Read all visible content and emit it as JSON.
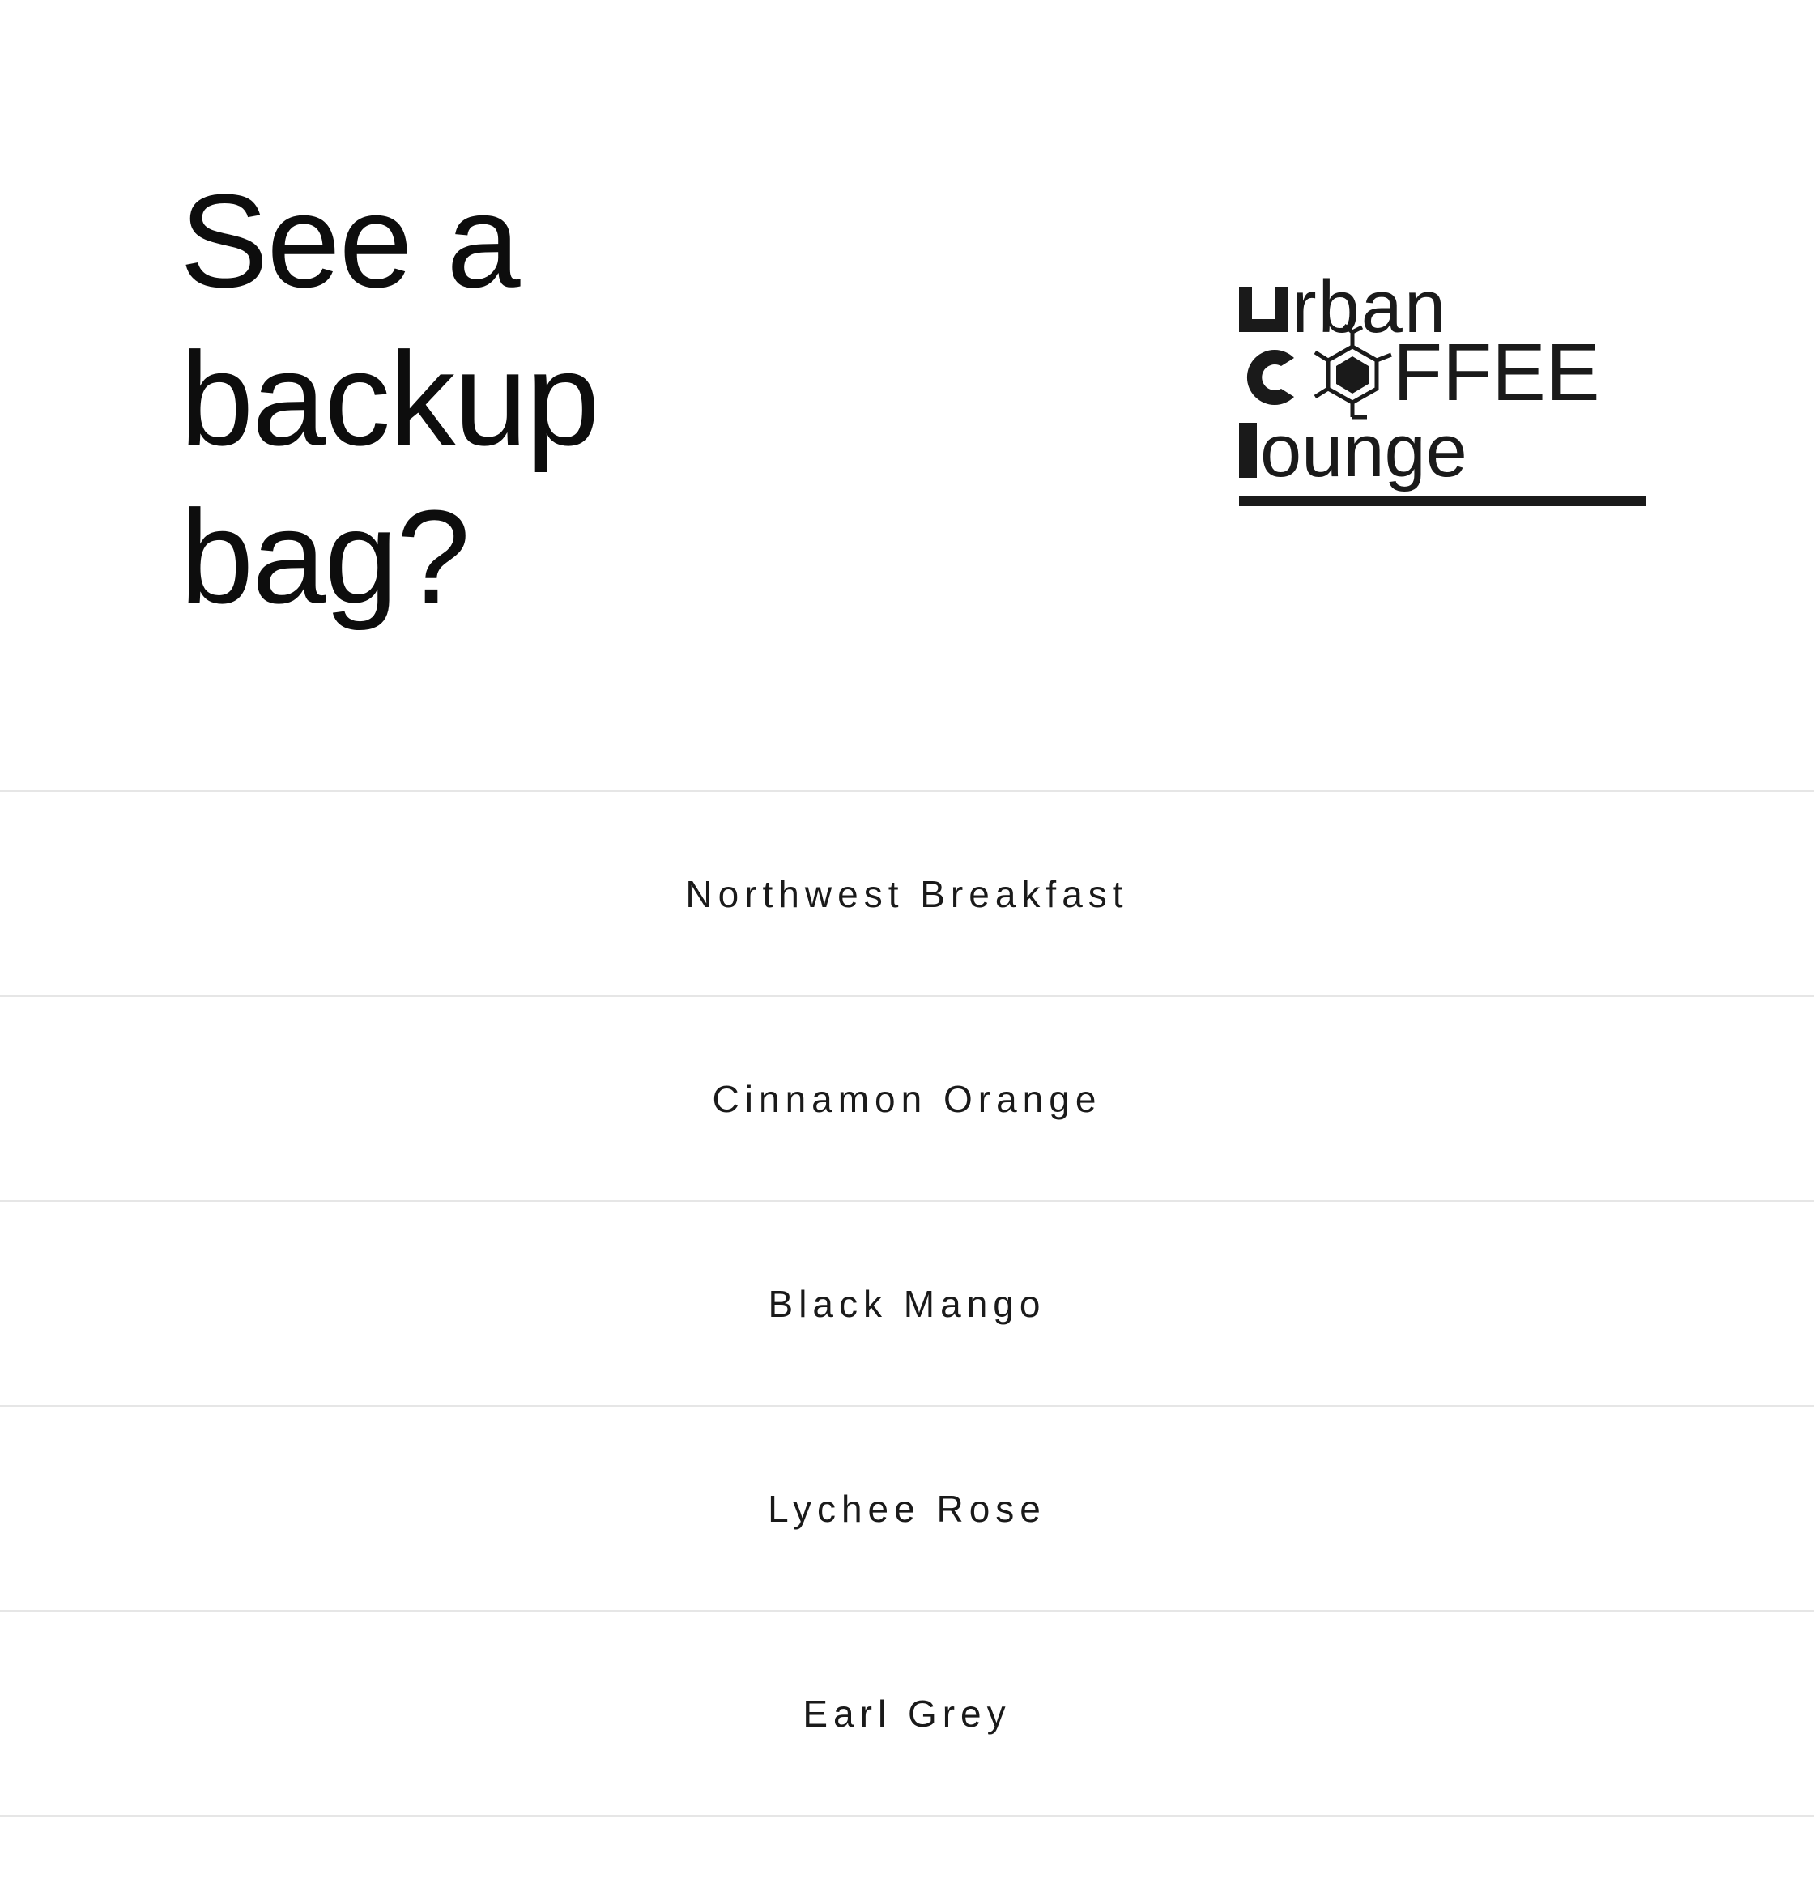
{
  "header": {
    "headline_lines": [
      "See a",
      "backup",
      "bag?"
    ]
  },
  "logo": {
    "alt": "urban COFFEE lounge",
    "icon": "urban-coffee-lounge-logo",
    "line1": "urban",
    "line2": "COFFEE",
    "line3": "lounge",
    "color": "#1a1a1a"
  },
  "bags": {
    "items": [
      {
        "label": "Northwest Breakfast"
      },
      {
        "label": "Cinnamon Orange"
      },
      {
        "label": "Black Mango"
      },
      {
        "label": "Lychee Rose"
      },
      {
        "label": "Earl Grey"
      }
    ]
  },
  "colors": {
    "text": "#111111",
    "divider": "#e6e6e6",
    "background": "#ffffff"
  }
}
